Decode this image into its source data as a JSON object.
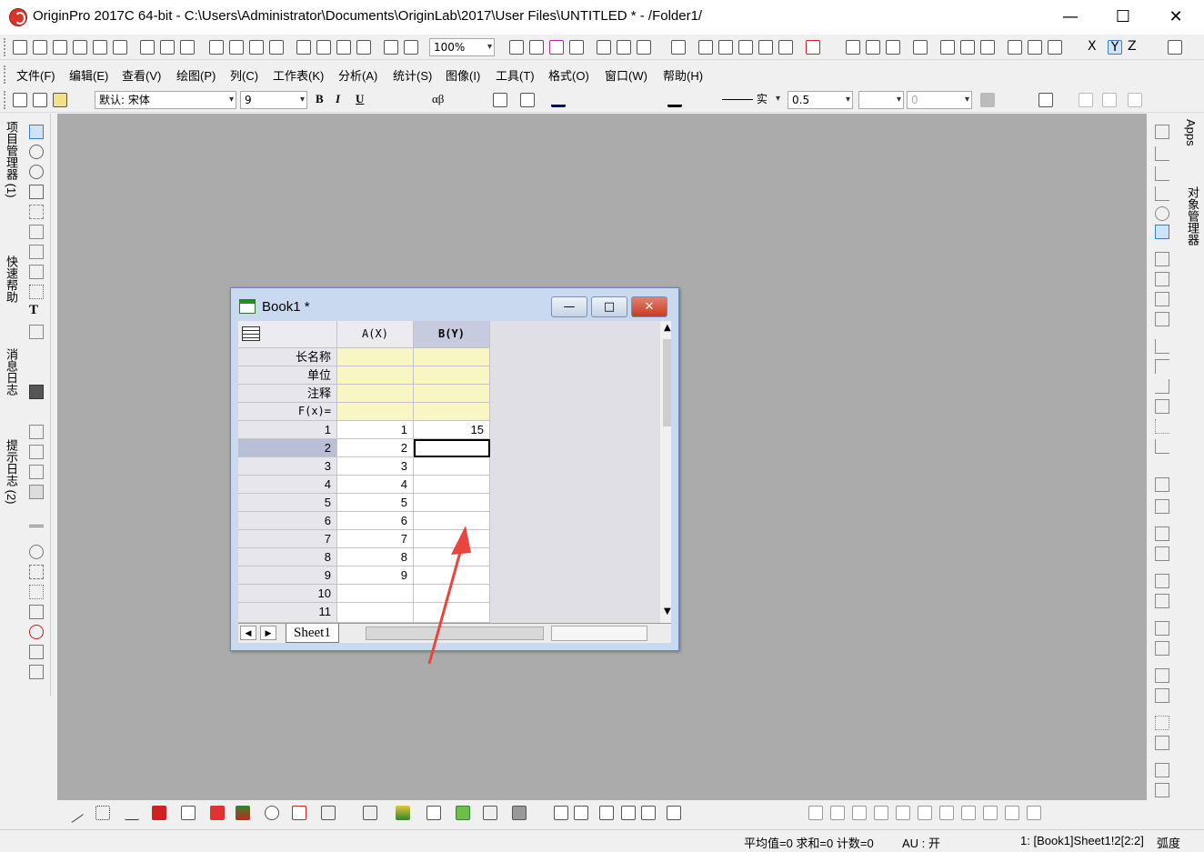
{
  "window": {
    "title": "OriginPro 2017C 64-bit - C:\\Users\\Administrator\\Documents\\OriginLab\\2017\\User Files\\UNTITLED * - /Folder1/",
    "minimize": "—",
    "maximize": "☐",
    "close": "✕"
  },
  "toolbar": {
    "zoom": "100%"
  },
  "menu": {
    "items": [
      "文件(F)",
      "编辑(E)",
      "查看(V)",
      "绘图(P)",
      "列(C)",
      "工作表(K)",
      "分析(A)",
      "统计(S)",
      "图像(I)",
      "工具(T)",
      "格式(O)",
      "窗口(W)",
      "帮助(H)"
    ]
  },
  "format": {
    "font": "默认: 宋体",
    "size": "9",
    "bold": "B",
    "italic": "I",
    "underline": "U",
    "greek": "αβ",
    "line_style": "实",
    "line_width": "0.5",
    "rotate": "0"
  },
  "left_dock": {
    "tabs": [
      "项目管理器 (1)",
      "快速帮助",
      "消息日志",
      "提示日志 (2)"
    ]
  },
  "right_dock": {
    "tabs": [
      "Apps",
      "对象管理器"
    ]
  },
  "book": {
    "title": "Book1 *",
    "min": "—",
    "max": "□",
    "close": "✕",
    "columns": [
      "A(X)",
      "B(Y)"
    ],
    "meta_rows": [
      "长名称",
      "单位",
      "注释",
      "F(x)="
    ],
    "rows": [
      {
        "n": "1",
        "a": "1",
        "b": "15"
      },
      {
        "n": "2",
        "a": "2",
        "b": ""
      },
      {
        "n": "3",
        "a": "3",
        "b": ""
      },
      {
        "n": "4",
        "a": "4",
        "b": ""
      },
      {
        "n": "5",
        "a": "5",
        "b": ""
      },
      {
        "n": "6",
        "a": "6",
        "b": ""
      },
      {
        "n": "7",
        "a": "7",
        "b": ""
      },
      {
        "n": "8",
        "a": "8",
        "b": ""
      },
      {
        "n": "9",
        "a": "9",
        "b": ""
      },
      {
        "n": "10",
        "a": "",
        "b": ""
      },
      {
        "n": "11",
        "a": "",
        "b": ""
      }
    ],
    "sheet_tab": "Sheet1",
    "selected_row": "2"
  },
  "status": {
    "stats": "平均值=0 求和=0 计数=0",
    "au": "AU : 开",
    "cell": "1: [Book1]Sheet1!2[2:2]",
    "unit": "弧度"
  },
  "colors": {
    "workspace": "#ababab",
    "meta_fill": "#f8f7c4",
    "arrow": "#e8453c"
  }
}
